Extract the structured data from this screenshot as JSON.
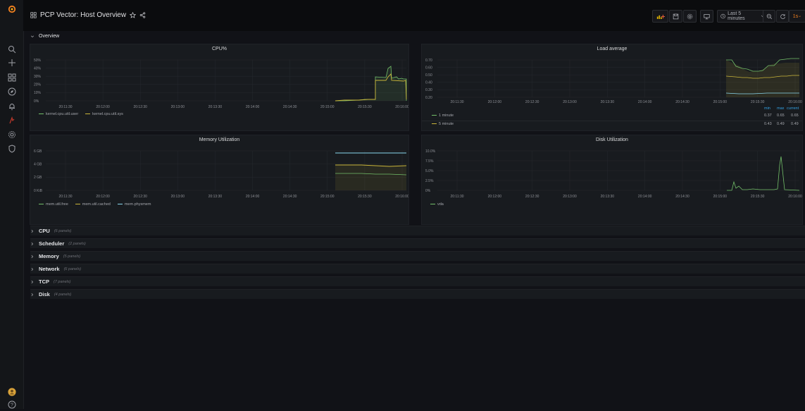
{
  "header": {
    "title": "PCP Vector: Host Overview",
    "time_range": "Last 5 minutes",
    "refresh": "1s"
  },
  "overview_row": {
    "title": "Overview"
  },
  "panels": {
    "cpu": {
      "title": "CPU%",
      "yticks": [
        "50%",
        "40%",
        "30%",
        "20%",
        "10%",
        "0%"
      ],
      "xticks": [
        "20:11:30",
        "20:12:00",
        "20:12:30",
        "20:13:00",
        "20:13:30",
        "20:14:00",
        "20:14:30",
        "20:15:00",
        "20:15:30",
        "20:16:00"
      ],
      "legend": [
        "kernel.cpu.util.user",
        "kernel.cpu.util.sys"
      ]
    },
    "load": {
      "title": "Load average",
      "yticks": [
        "0.70",
        "0.60",
        "0.50",
        "0.40",
        "0.30",
        "0.20"
      ],
      "xticks": [
        "20:11:30",
        "20:12:00",
        "20:12:30",
        "20:13:00",
        "20:13:30",
        "20:14:00",
        "20:14:30",
        "20:15:00",
        "20:15:30",
        "20:16:00"
      ],
      "legend_headers": [
        "min",
        "max",
        "current"
      ],
      "legend_rows": [
        {
          "name": "1 minute",
          "min": "0.37",
          "max": "0.65",
          "current": "0.65"
        },
        {
          "name": "5 minute",
          "min": "0.43",
          "max": "0.49",
          "current": "0.49"
        }
      ]
    },
    "memory": {
      "title": "Memory Utilization",
      "yticks": [
        "6 GB",
        "4 GB",
        "2 GB",
        "0 KiB"
      ],
      "xticks": [
        "20:11:30",
        "20:12:00",
        "20:12:30",
        "20:13:00",
        "20:13:30",
        "20:14:00",
        "20:14:30",
        "20:15:00",
        "20:15:30",
        "20:16:00"
      ],
      "legend": [
        "mem.util.free",
        "mem.util.cached",
        "mem.physmem"
      ]
    },
    "disk": {
      "title": "Disk Utilization",
      "yticks": [
        "10.0%",
        "7.5%",
        "5.0%",
        "2.5%",
        "0%"
      ],
      "xticks": [
        "20:11:30",
        "20:12:00",
        "20:12:30",
        "20:13:00",
        "20:13:30",
        "20:14:00",
        "20:14:30",
        "20:15:00",
        "20:15:30",
        "20:16:00"
      ],
      "legend": [
        "vda"
      ]
    }
  },
  "collapsed_rows": [
    {
      "title": "CPU",
      "count": "(6 panels)"
    },
    {
      "title": "Scheduler",
      "count": "(2 panels)"
    },
    {
      "title": "Memory",
      "count": "(5 panels)"
    },
    {
      "title": "Network",
      "count": "(6 panels)"
    },
    {
      "title": "TCP",
      "count": "(7 panels)"
    },
    {
      "title": "Disk",
      "count": "(4 panels)"
    }
  ],
  "colors": {
    "green": "#73bf69",
    "yellow": "#c9b53a",
    "cyan": "#8ad8ef",
    "accent": "#f5821f"
  }
}
